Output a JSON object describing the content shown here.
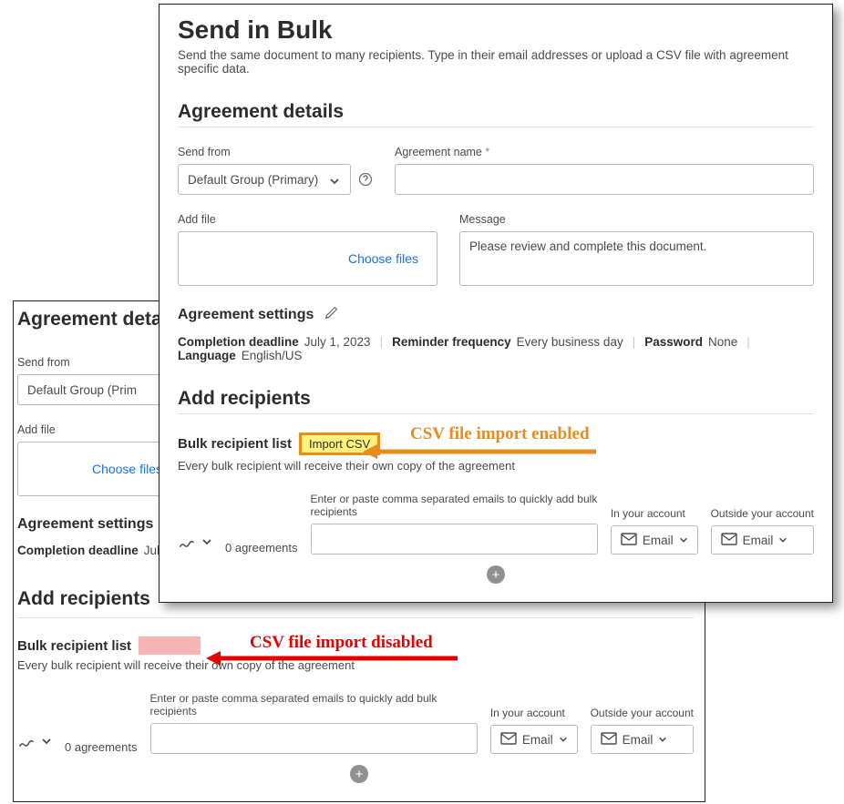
{
  "page": {
    "title": "Send in Bulk",
    "subtitle": "Send the same document to many recipients. Type in their email addresses or upload a CSV file with agreement specific data."
  },
  "sections": {
    "agreement_details": "Agreement details",
    "add_recipients": "Add recipients",
    "agreement_settings": "Agreement settings"
  },
  "fields": {
    "send_from_label": "Send from",
    "send_from_value": "Default Group (Primary)",
    "agreement_name_label": "Agreement name",
    "add_file_label": "Add file",
    "choose_files": "Choose files",
    "message_label": "Message",
    "message_value": "Please review and complete this document."
  },
  "settings": {
    "completion_deadline_k": "Completion deadline",
    "completion_deadline_v": "July 1, 2023",
    "reminder_k": "Reminder frequency",
    "reminder_v": "Every business day",
    "password_k": "Password",
    "password_v": "None",
    "language_k": "Language",
    "language_v": "English/US"
  },
  "recipients": {
    "bulk_label": "Bulk recipient list",
    "import_csv": "Import CSV",
    "bulk_desc": "Every bulk recipient will receive their own copy of the agreement",
    "agreements_count": "0 agreements",
    "email_hint": "Enter or paste comma separated emails to quickly add bulk recipients",
    "in_account": "In your account",
    "outside_account": "Outside your account",
    "email_btn": "Email"
  },
  "back": {
    "completion_deadline_v_partial": "July"
  },
  "annotations": {
    "enabled": "CSV file import enabled",
    "disabled": "CSV file import disabled"
  }
}
